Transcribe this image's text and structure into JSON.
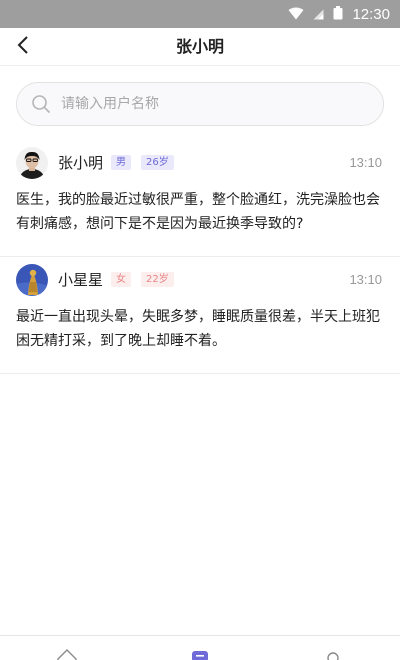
{
  "status_bar": {
    "time": "12:30"
  },
  "header": {
    "title": "张小明"
  },
  "search": {
    "placeholder": "请输入用户名称"
  },
  "messages": [
    {
      "name": "张小明",
      "gender": "男",
      "age": "26岁",
      "time": "13:10",
      "content": "医生，我的脸最近过敏很严重，整个脸通红，洗完澡脸也会有刺痛感，想问下是不是因为最近换季导致的?",
      "badge_color": "#6f6ad8"
    },
    {
      "name": "小星星",
      "gender": "女",
      "age": "22岁",
      "time": "13:10",
      "content": "最近一直出现头晕，失眠多梦，睡眠质量很差，半天上班犯困无精打采，到了晚上却睡不着。",
      "badge_color": "#ea8585"
    }
  ],
  "tabs": [
    {
      "icon": "home-icon"
    },
    {
      "icon": "message-icon",
      "active": true,
      "color": "#6f6ad8"
    },
    {
      "icon": "profile-icon"
    }
  ]
}
